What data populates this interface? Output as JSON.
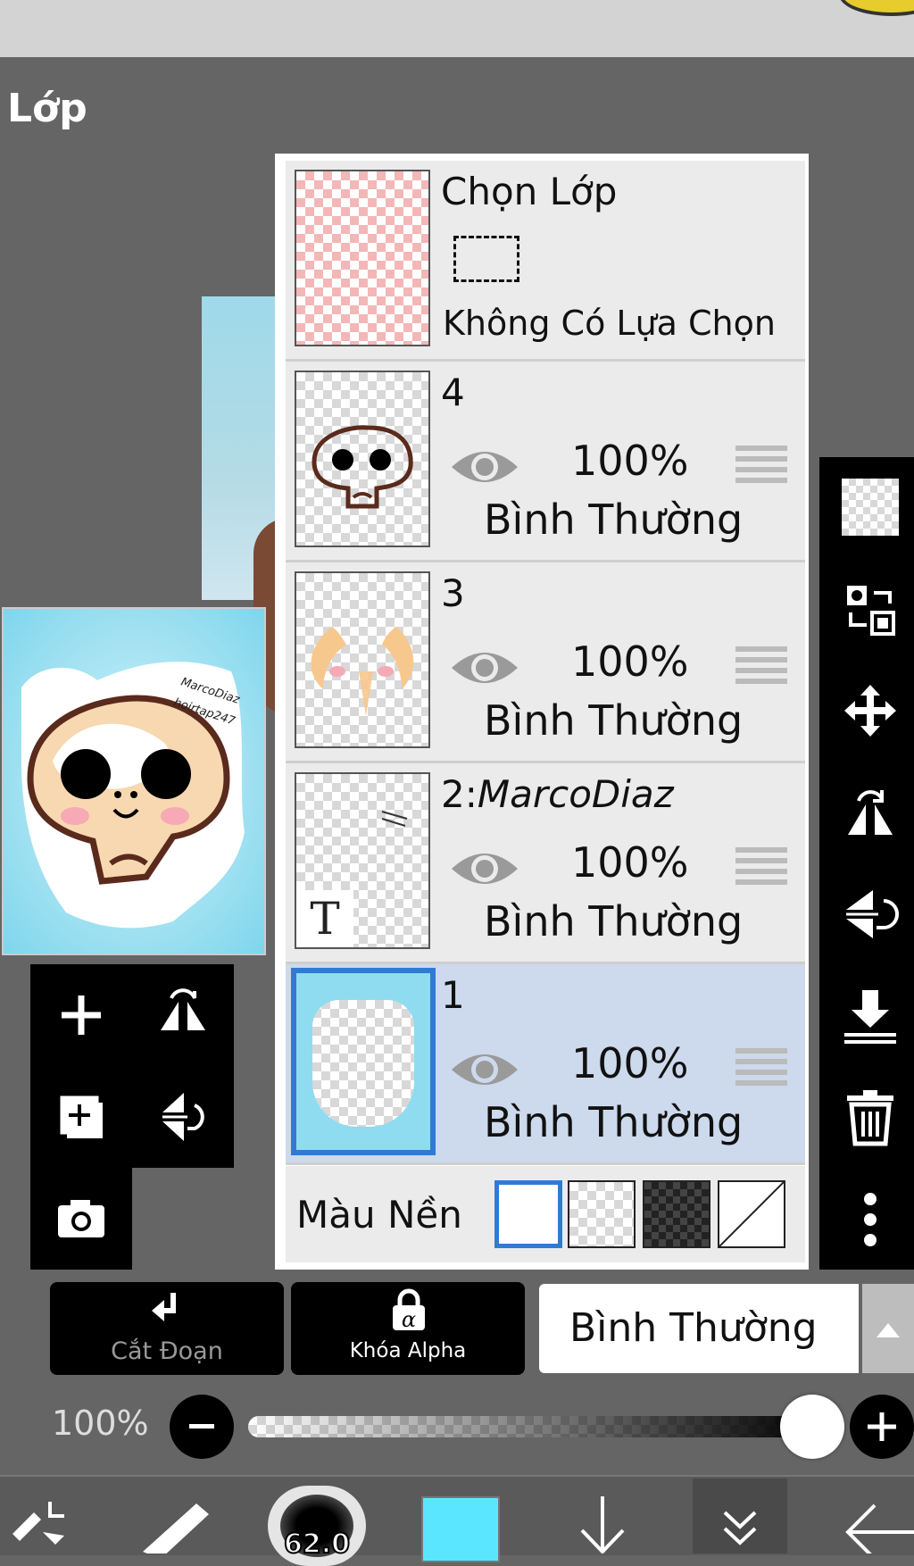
{
  "panel_title": "Lớp",
  "selection_layer": {
    "title": "Chọn Lớp",
    "subtitle": "Không Có Lựa Chọn"
  },
  "layers": [
    {
      "name": "4",
      "opacity": "100%",
      "blend": "Bình Thường",
      "visible": true,
      "selected": false
    },
    {
      "name": "3",
      "opacity": "100%",
      "blend": "Bình Thường",
      "visible": true,
      "selected": false
    },
    {
      "name_prefix": "2:",
      "name_italic": "MarcoDiaz",
      "opacity": "100%",
      "blend": "Bình Thường",
      "visible": true,
      "selected": false,
      "type": "text"
    },
    {
      "name": "1",
      "opacity": "100%",
      "blend": "Bình Thường",
      "visible": true,
      "selected": true
    }
  ],
  "background": {
    "label": "Màu Nền",
    "options": [
      "white",
      "transparent",
      "dark-checker",
      "none"
    ],
    "selected_index": 0
  },
  "canvas_text": {
    "line1": "MarcoDiaz",
    "line2": "hoirtap247"
  },
  "bottom_bar": {
    "clipping_label": "Cắt Đoạn",
    "alpha_lock_label": "Khóa Alpha",
    "blend_mode": "Bình Thường"
  },
  "opacity_slider": {
    "label": "100%",
    "value": 1.0
  },
  "toolbar": {
    "brush_size": "62.0"
  },
  "colors": {
    "selected_blue": "#2f7bd4",
    "current_color": "#5ae6ff",
    "selected_row": "#cdd9ec"
  },
  "right_tools": [
    "checker-icon",
    "transfer-icon",
    "move-icon",
    "flip-horizontal-icon",
    "flip-vertical-icon",
    "merge-down-icon",
    "trash-icon",
    "more-icon"
  ],
  "left_tools": [
    "add-layer-icon",
    "flip-layer-horizontal-icon",
    "duplicate-layer-icon",
    "flip-layer-vertical-icon",
    "camera-icon"
  ]
}
